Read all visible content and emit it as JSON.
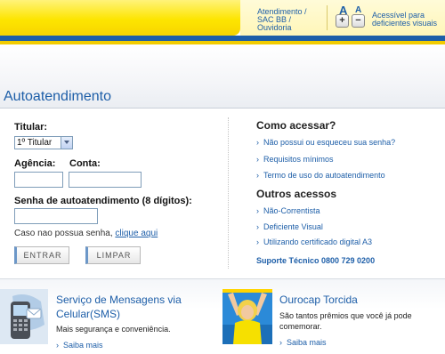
{
  "header": {
    "link_atendimento": "Atendimento /",
    "link_sac": "SAC BB /",
    "link_ouvidoria": "Ouvidoria",
    "font_big_letter": "A",
    "font_small_letter": "A",
    "font_increase": "+",
    "font_decrease": "−",
    "accessible_line1": "Acessível para",
    "accessible_line2": "deficientes visuais",
    "colors": {
      "yellow": "#fde500",
      "blue": "#1d5ea8"
    }
  },
  "page": {
    "title": "Autoatendimento"
  },
  "form": {
    "titular_label": "Titular:",
    "titular_value": "1º Titular",
    "agencia_label": "Agência:",
    "conta_label": "Conta:",
    "agencia_value": "",
    "conta_value": "",
    "senha_label": "Senha de autoatendimento (8 dígitos):",
    "senha_value": "",
    "no_password_text": "Caso nao possua senha, ",
    "no_password_link": "clique aqui",
    "entrar_label": "ENTRAR",
    "limpar_label": "LIMPAR"
  },
  "access": {
    "como_acessar_title": "Como acessar?",
    "como_links": [
      "Não possui ou esqueceu sua senha?",
      "Requisitos mínimos",
      "Termo de uso do autoatendimento"
    ],
    "outros_title": "Outros acessos",
    "outros_links": [
      "Não-Correntista",
      "Deficiente Visual",
      "Utilizando certificado digital A3"
    ],
    "suporte": "Suporte Técnico 0800 729 0200"
  },
  "promos": {
    "sms": {
      "title_1": "Serviço de Mensagens via",
      "title_2": "Celular(SMS)",
      "desc": "Mais segurança e conveniência.",
      "saiba": "Saiba mais"
    },
    "torcida": {
      "title": "Ourocap Torcida",
      "desc_1": "São tantos prêmios que você já pode",
      "desc_2": "comemorar.",
      "saiba": "Saiba mais"
    }
  },
  "icons": {
    "link_chevron": "›",
    "sms_image": "mobile-phone-image",
    "torcida_image": "cheering-woman-image"
  }
}
